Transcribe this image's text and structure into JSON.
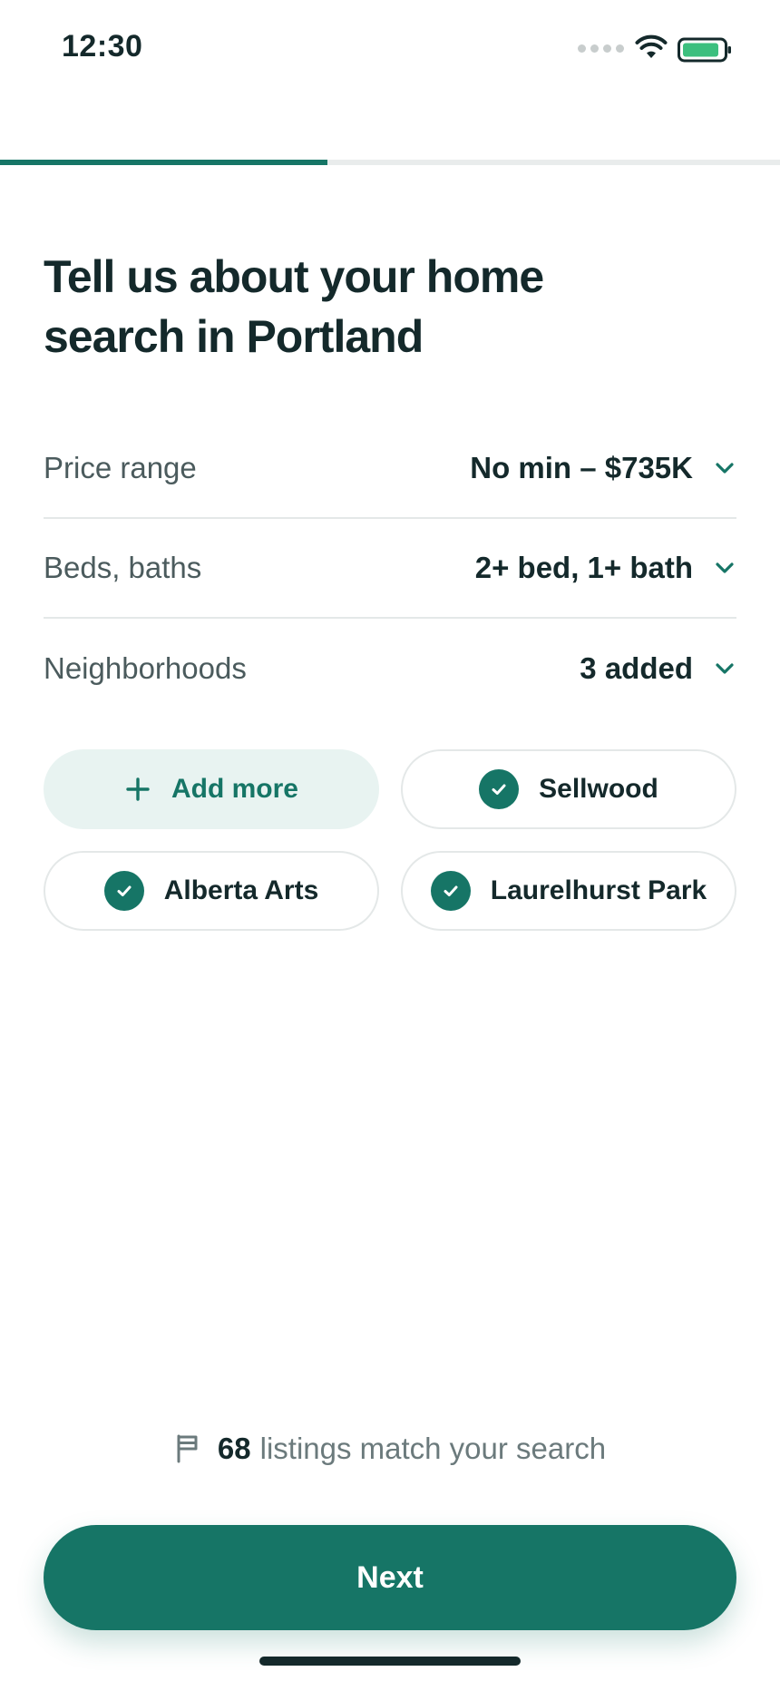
{
  "status_bar": {
    "time": "12:30",
    "battery_color": "#3cbf7e"
  },
  "progress": {
    "fraction": 0.42,
    "color": "#167566"
  },
  "title": "Tell us about your home search in Portland",
  "filters": [
    {
      "label": "Price range",
      "value": "No min – $735K",
      "icon": "chevron-down-icon"
    },
    {
      "label": "Beds, baths",
      "value": "2+ bed, 1+ bath",
      "icon": "chevron-down-icon"
    },
    {
      "label": "Neighborhoods",
      "value": "3 added",
      "icon": "chevron-down-icon"
    }
  ],
  "neighborhoods": {
    "add_label": "Add more",
    "selected": [
      "Sellwood",
      "Alberta Arts",
      "Laurelhurst Park"
    ]
  },
  "listings": {
    "count": "68",
    "text": "listings match your search"
  },
  "next_label": "Next",
  "colors": {
    "accent": "#167566",
    "accent_light": "#e8f3f1",
    "text": "#14292b"
  }
}
